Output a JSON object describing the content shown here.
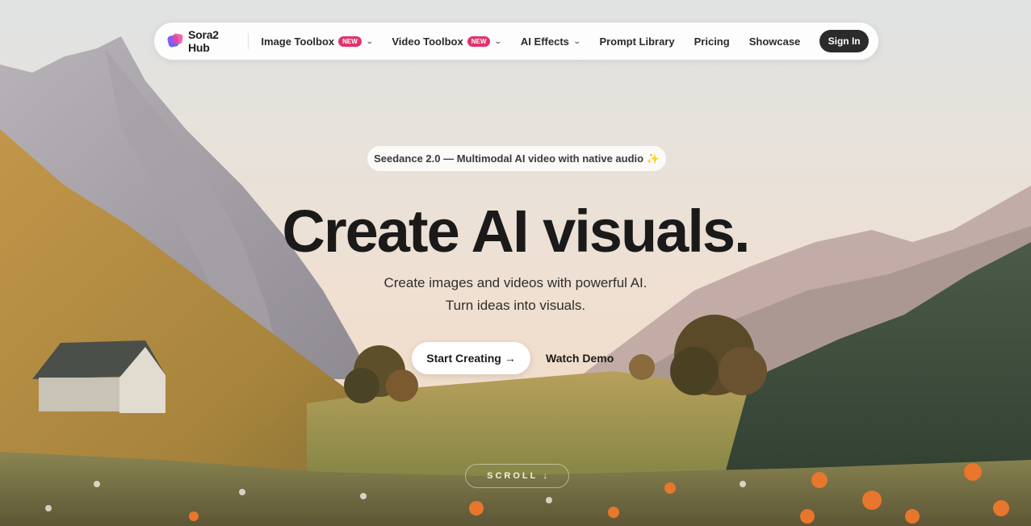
{
  "nav": {
    "brand": "Sora2 Hub",
    "items": [
      {
        "label": "Image Toolbox",
        "badge": "NEW",
        "dropdown": true
      },
      {
        "label": "Video Toolbox",
        "badge": "NEW",
        "dropdown": true
      },
      {
        "label": "AI Effects",
        "dropdown": true
      },
      {
        "label": "Prompt Library"
      },
      {
        "label": "Pricing"
      },
      {
        "label": "Showcase"
      }
    ],
    "signin": "Sign In"
  },
  "hero": {
    "announcement": "Seedance 2.0 — Multimodal AI video with native audio ✨",
    "headline": "Create AI visuals.",
    "subline1": "Create images and videos with powerful AI.",
    "subline2": "Turn ideas into visuals.",
    "cta_primary": "Start Creating →",
    "cta_secondary": "Watch Demo",
    "scroll_label": "SCROLL",
    "scroll_arrow": "↓"
  },
  "colors": {
    "badge": "#e0336c",
    "signin_bg": "#2b2b2b",
    "headline": "#1a1a1a"
  },
  "icons": [
    "brand-logo-icon",
    "chevron-down-icon",
    "arrow-down-icon"
  ]
}
